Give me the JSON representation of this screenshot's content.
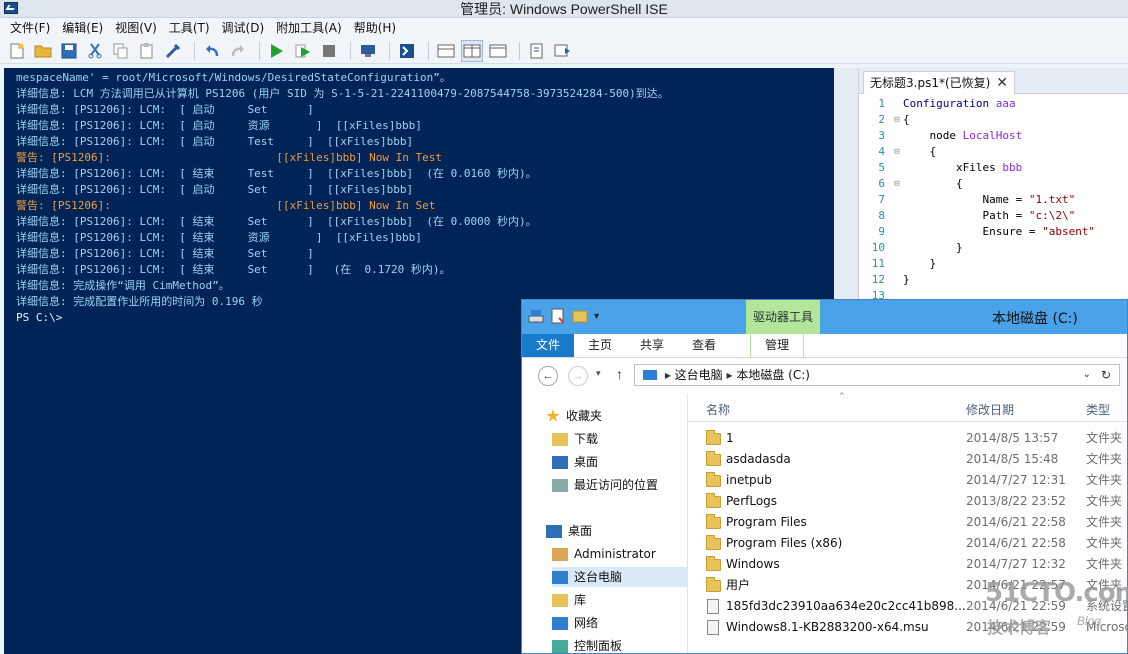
{
  "ise": {
    "title": "管理员: Windows PowerShell ISE",
    "menu": [
      "文件(F)",
      "编辑(E)",
      "视图(V)",
      "工具(T)",
      "调试(D)",
      "附加工具(A)",
      "帮助(H)"
    ],
    "console_lines": [
      {
        "text": "mespaceName' = root/Microsoft/Windows/DesiredStateConfiguration”。",
        "kind": "verbose"
      },
      {
        "text": "详细信息: LCM 方法调用已从计算机 PS1206 (用户 SID 为 S-1-5-21-2241100479-2087544758-3973524284-500)到达。",
        "kind": "verbose"
      },
      {
        "text": "详细信息: [PS1206]: LCM:  [ 启动     Set      ]",
        "kind": "verbose"
      },
      {
        "text": "详细信息: [PS1206]: LCM:  [ 启动     资源       ]  [[xFiles]bbb]",
        "kind": "verbose"
      },
      {
        "text": "详细信息: [PS1206]: LCM:  [ 启动     Test     ]  [[xFiles]bbb]",
        "kind": "verbose"
      },
      {
        "text": "警告: [PS1206]:                         [[xFiles]bbb] Now In Test",
        "kind": "warn"
      },
      {
        "text": "详细信息: [PS1206]: LCM:  [ 结束     Test     ]  [[xFiles]bbb]  (在 0.0160 秒内)。",
        "kind": "verbose"
      },
      {
        "text": "详细信息: [PS1206]: LCM:  [ 启动     Set      ]  [[xFiles]bbb]",
        "kind": "verbose"
      },
      {
        "text": "警告: [PS1206]:                         [[xFiles]bbb] Now In Set",
        "kind": "warn"
      },
      {
        "text": "详细信息: [PS1206]: LCM:  [ 结束     Set      ]  [[xFiles]bbb]  (在 0.0000 秒内)。",
        "kind": "verbose"
      },
      {
        "text": "详细信息: [PS1206]: LCM:  [ 结束     资源       ]  [[xFiles]bbb]",
        "kind": "verbose"
      },
      {
        "text": "详细信息: [PS1206]: LCM:  [ 结束     Set      ]",
        "kind": "verbose"
      },
      {
        "text": "详细信息: [PS1206]: LCM:  [ 结束     Set      ]   (在  0.1720 秒内)。",
        "kind": "verbose"
      },
      {
        "text": "详细信息: 完成操作“调用 CimMethod”。",
        "kind": "verbose"
      },
      {
        "text": "详细信息: 完成配置作业所用的时间为 0.196 秒",
        "kind": "verbose"
      },
      {
        "text": "",
        "kind": "blank"
      },
      {
        "text": "",
        "kind": "blank"
      },
      {
        "text": "",
        "kind": "blank"
      },
      {
        "text": "PS C:\\>",
        "kind": "prompt"
      }
    ],
    "script_tab": "无标题3.ps1*(已恢复)",
    "script_tab_close": "✕",
    "code": [
      {
        "no": "1",
        "fold": "",
        "parts": [
          [
            "kw",
            "Configuration "
          ],
          [
            "nm",
            "aaa"
          ]
        ]
      },
      {
        "no": "2",
        "fold": "⊟",
        "parts": [
          [
            "tx",
            "{"
          ]
        ]
      },
      {
        "no": "3",
        "fold": "",
        "parts": [
          [
            "tx",
            "    node "
          ],
          [
            "nm",
            "LocalHost"
          ]
        ]
      },
      {
        "no": "4",
        "fold": "⊟",
        "parts": [
          [
            "tx",
            "    {"
          ]
        ]
      },
      {
        "no": "5",
        "fold": "",
        "parts": [
          [
            "tx",
            "        xFiles "
          ],
          [
            "nm",
            "bbb"
          ]
        ]
      },
      {
        "no": "6",
        "fold": "⊟",
        "parts": [
          [
            "tx",
            "        {"
          ]
        ]
      },
      {
        "no": "7",
        "fold": "",
        "parts": [
          [
            "tx",
            "            Name = "
          ],
          [
            "str",
            "\"1.txt\""
          ]
        ]
      },
      {
        "no": "8",
        "fold": "",
        "parts": [
          [
            "tx",
            "            Path = "
          ],
          [
            "str",
            "\"c:\\2\\\""
          ]
        ]
      },
      {
        "no": "9",
        "fold": "",
        "parts": [
          [
            "tx",
            "            Ensure = "
          ],
          [
            "str",
            "\"absent\""
          ]
        ]
      },
      {
        "no": "10",
        "fold": "",
        "parts": [
          [
            "tx",
            "        }"
          ]
        ]
      },
      {
        "no": "11",
        "fold": "",
        "parts": [
          [
            "tx",
            "    }"
          ]
        ]
      },
      {
        "no": "12",
        "fold": "",
        "parts": [
          [
            "tx",
            "}"
          ]
        ]
      },
      {
        "no": "13",
        "fold": "",
        "parts": [
          [
            "tx",
            ""
          ]
        ]
      }
    ]
  },
  "explorer": {
    "title": "本地磁盘 (C:)",
    "context_tab": "驱动器工具",
    "tabs": [
      "文件",
      "主页",
      "共享",
      "查看",
      "管理"
    ],
    "address": [
      "这台电脑",
      "本地磁盘 (C:)"
    ],
    "nav": [
      {
        "label": "收藏夹",
        "icon": "star-icon",
        "indent": 0
      },
      {
        "label": "下载",
        "icon": "folder-icon",
        "indent": 1
      },
      {
        "label": "桌面",
        "icon": "desktop-icon",
        "indent": 1
      },
      {
        "label": "最近访问的位置",
        "icon": "recent-icon",
        "indent": 1
      },
      {
        "label": "桌面",
        "icon": "desktop-icon",
        "indent": 0
      },
      {
        "label": "Administrator",
        "icon": "user-icon",
        "indent": 1
      },
      {
        "label": "这台电脑",
        "icon": "computer-icon",
        "indent": 1
      },
      {
        "label": "库",
        "icon": "library-icon",
        "indent": 1
      },
      {
        "label": "网络",
        "icon": "network-icon",
        "indent": 1
      },
      {
        "label": "控制面板",
        "icon": "control-panel-icon",
        "indent": 1
      }
    ],
    "columns": [
      "名称",
      "修改日期",
      "类型"
    ],
    "rows": [
      {
        "name": "1",
        "date": "2014/8/5 13:57",
        "type": "文件夹",
        "icon": "folder"
      },
      {
        "name": "asdadasda",
        "date": "2014/8/5 15:48",
        "type": "文件夹",
        "icon": "folder"
      },
      {
        "name": "inetpub",
        "date": "2014/7/27 12:31",
        "type": "文件夹",
        "icon": "folder"
      },
      {
        "name": "PerfLogs",
        "date": "2013/8/22 23:52",
        "type": "文件夹",
        "icon": "folder"
      },
      {
        "name": "Program Files",
        "date": "2014/6/21 22:58",
        "type": "文件夹",
        "icon": "folder"
      },
      {
        "name": "Program Files (x86)",
        "date": "2014/6/21 22:58",
        "type": "文件夹",
        "icon": "folder"
      },
      {
        "name": "Windows",
        "date": "2014/7/27 12:32",
        "type": "文件夹",
        "icon": "folder"
      },
      {
        "name": "用户",
        "date": "2014/6/21 22:57",
        "type": "文件夹",
        "icon": "folder"
      },
      {
        "name": "185fd3dc23910aa634e20c2cc41b898...",
        "date": "2014/6/21 22:59",
        "type": "系统设置",
        "icon": "file"
      },
      {
        "name": "Windows8.1-KB2883200-x64.msu",
        "date": "2014/6/21 22:59",
        "type": "Microsoft",
        "icon": "file"
      }
    ]
  },
  "watermark": {
    "main": "51CTO.com",
    "sub": "技术博客",
    "blog": "Blog"
  }
}
